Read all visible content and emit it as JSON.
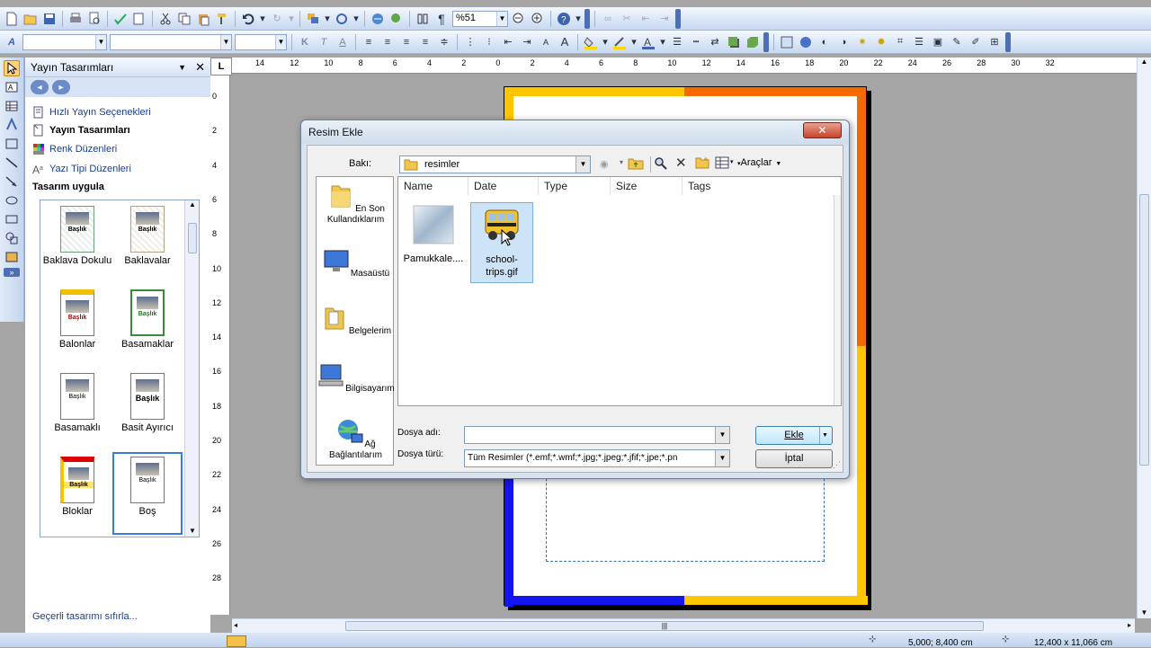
{
  "toolbar": {
    "zoom": "%51"
  },
  "taskpane": {
    "title": "Yayın Tasarımları",
    "links": {
      "quick_options": "Hızlı Yayın Seçenekleri",
      "designs": "Yayın Tasarımları",
      "color_schemes": "Renk Düzenleri",
      "font_schemes": "Yazı Tipi Düzenleri"
    },
    "apply_design_label": "Tasarım uygula",
    "designs": [
      {
        "name": "Baklava Dokulu",
        "thumb_text": "Başlık"
      },
      {
        "name": "Baklavalar",
        "thumb_text": "Başlık"
      },
      {
        "name": "Balonlar",
        "thumb_text": "Başlık"
      },
      {
        "name": "Basamaklar",
        "thumb_text": "Başlık"
      },
      {
        "name": "Basamaklı",
        "thumb_text": "Başlık"
      },
      {
        "name": "Basit Ayırıcı",
        "thumb_text": "Başlık"
      },
      {
        "name": "Bloklar",
        "thumb_text": "Başlık"
      },
      {
        "name": "Boş",
        "thumb_text": "Başlık"
      }
    ],
    "reset_link": "Geçerli tasarımı sıfırla..."
  },
  "ruler": {
    "corner": "L",
    "h_ticks": [
      "14",
      "12",
      "10",
      "8",
      "6",
      "4",
      "2",
      "0",
      "2",
      "4",
      "6",
      "8",
      "10",
      "12",
      "14",
      "16",
      "18",
      "20",
      "22",
      "24",
      "26",
      "28",
      "30",
      "32"
    ],
    "v_ticks": [
      "0",
      "2",
      "4",
      "6",
      "8",
      "10",
      "12",
      "14",
      "16",
      "18",
      "20",
      "22",
      "24",
      "26",
      "28"
    ]
  },
  "dialog": {
    "title": "Resim Ekle",
    "lookin_label": "Bakı:",
    "lookin_value": "resimler",
    "tools_label": "Araçlar",
    "places": [
      {
        "label": "En Son Kullandıklarım",
        "icon": "recent-folder-icon"
      },
      {
        "label": "Masaüstü",
        "icon": "desktop-icon"
      },
      {
        "label": "Belgelerim",
        "icon": "documents-folder-icon"
      },
      {
        "label": "Bilgisayarım",
        "icon": "computer-icon"
      },
      {
        "label": "Ağ Bağlantılarım",
        "icon": "network-icon"
      }
    ],
    "columns": [
      "Name",
      "Date",
      "Type",
      "Size",
      "Tags"
    ],
    "files": [
      {
        "name": "Pamukkale....",
        "selected": false
      },
      {
        "name": "school-trips.gif",
        "selected": true
      }
    ],
    "filename_label": "Dosya adı:",
    "filename_value": "",
    "filetype_label": "Dosya türü:",
    "filetype_value": "Tüm Resimler (*.emf;*.wmf;*.jpg;*.jpeg;*.jfif;*.jpe;*.pn",
    "insert_button": "Ekle",
    "cancel_button": "İptal"
  },
  "statusbar": {
    "position": "5,000; 8,400 cm",
    "size": "12,400 x 11,066 cm"
  }
}
